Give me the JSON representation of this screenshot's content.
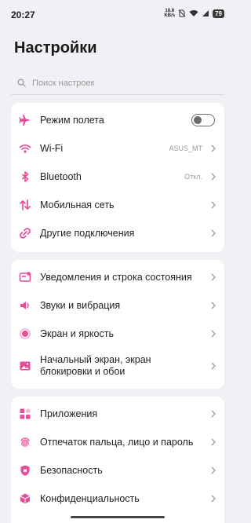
{
  "status_bar": {
    "time": "20:27",
    "net_speed_value": "18.8",
    "net_speed_unit": "KB/s",
    "battery": "79"
  },
  "header": {
    "title": "Настройки"
  },
  "search": {
    "placeholder": "Поиск настроек",
    "icon": "search-icon"
  },
  "accent_color": "#e84b9a",
  "group1": [
    {
      "label": "Режим полета",
      "icon": "airplane-icon",
      "toggle": "off"
    },
    {
      "label": "Wi-Fi",
      "value": "ASUS_MT",
      "icon": "wifi-icon"
    },
    {
      "label": "Bluetooth",
      "value": "Откл.",
      "icon": "bluetooth-icon"
    },
    {
      "label": "Мобильная сеть",
      "icon": "mobile-data-icon"
    },
    {
      "label": "Другие подключения",
      "icon": "link-icon"
    }
  ],
  "group2": [
    {
      "label": "Уведомления и строка состояния",
      "icon": "notification-icon"
    },
    {
      "label": "Звуки и вибрация",
      "icon": "speaker-icon"
    },
    {
      "label": "Экран и яркость",
      "icon": "display-icon"
    },
    {
      "label_line1": "Начальный экран, экран",
      "label_line2": "блокировки и обои",
      "icon": "wallpaper-icon"
    }
  ],
  "group3": [
    {
      "label": "Приложения",
      "icon": "apps-icon"
    },
    {
      "label": "Отпечаток пальца, лицо и пароль",
      "icon": "fingerprint-icon"
    },
    {
      "label": "Безопасность",
      "icon": "shield-icon"
    },
    {
      "label": "Конфиденциальность",
      "icon": "privacy-icon"
    }
  ]
}
